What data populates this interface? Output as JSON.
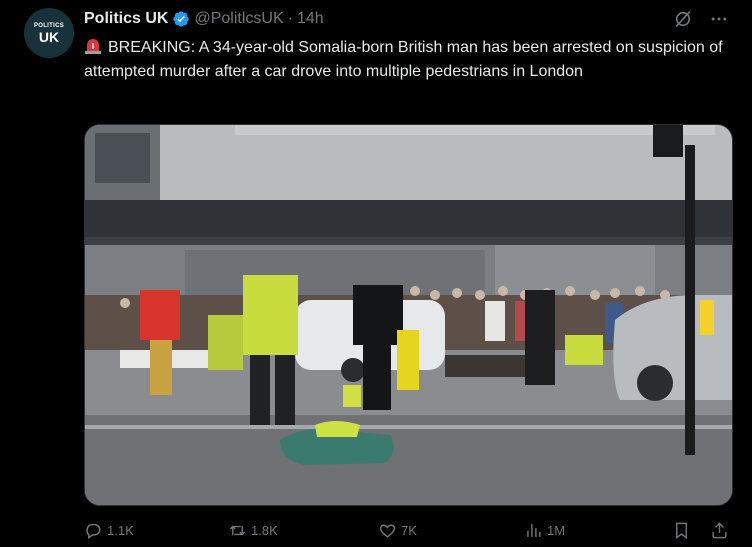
{
  "tweet": {
    "author_name": "Politics UK",
    "handle": "@PolitlcsUK",
    "separator": "·",
    "time": "14h",
    "avatar_text_small": "POLITICS",
    "avatar_text_big": "UK",
    "text": "BREAKING: A 34-year-old Somalia-born British man has been arrested on suspicion of attempted murder after a car drove into multiple pedestrians in London",
    "media_icon": "news-photo-street-scene",
    "colors": {
      "background": "#000000",
      "text": "#e7e9ea",
      "muted": "#71767b",
      "verified": "#1d9bf0",
      "siren": "#e0343a"
    }
  },
  "actions": {
    "replies": "1.1K",
    "reposts": "1.8K",
    "likes": "7K",
    "views": "1M"
  },
  "icons": {
    "verified": "verified-badge-icon",
    "siren": "siren-emoji-icon",
    "grok": "grok-icon",
    "more": "more-icon",
    "reply": "reply-icon",
    "repost": "repost-icon",
    "like": "like-icon",
    "views": "views-icon",
    "bookmark": "bookmark-icon",
    "share": "share-icon"
  }
}
